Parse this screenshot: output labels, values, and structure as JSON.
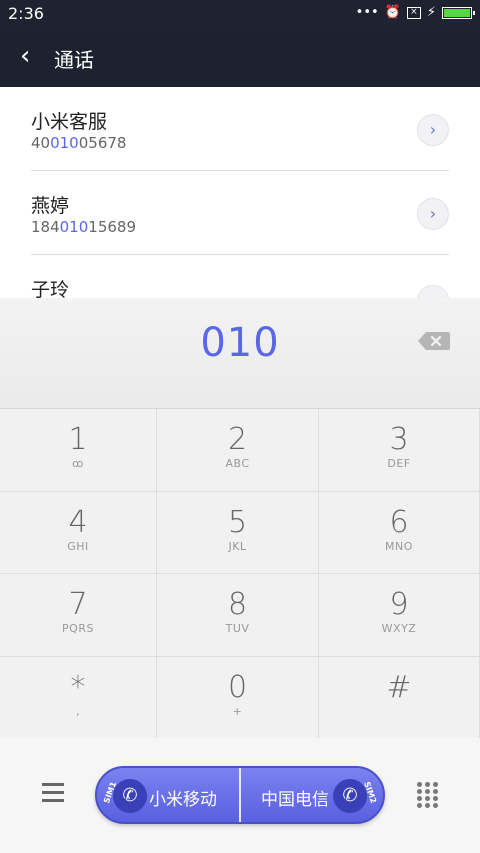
{
  "status_bar": {
    "time": "2:36",
    "dots": "•••",
    "alarm": "⏰",
    "box_x": "×",
    "bolt": "⚡",
    "battery_level": 1.0
  },
  "header": {
    "back_icon": "‹",
    "title": "通话"
  },
  "contacts": [
    {
      "name": "小米客服",
      "num_pre": "40",
      "num_hl": "010",
      "num_post": "05678"
    },
    {
      "name": "燕婷",
      "num_pre": "184",
      "num_hl": "010",
      "num_post": "15689"
    },
    {
      "name": "子玲",
      "num_pre": "",
      "num_hl": "",
      "num_post": ""
    }
  ],
  "dial_input": {
    "value": "010"
  },
  "keypad": [
    {
      "digit": "1",
      "letters": "ꝏ"
    },
    {
      "digit": "2",
      "letters": "ABC"
    },
    {
      "digit": "3",
      "letters": "DEF"
    },
    {
      "digit": "4",
      "letters": "GHI"
    },
    {
      "digit": "5",
      "letters": "JKL"
    },
    {
      "digit": "6",
      "letters": "MNO"
    },
    {
      "digit": "7",
      "letters": "PQRS"
    },
    {
      "digit": "8",
      "letters": "TUV"
    },
    {
      "digit": "9",
      "letters": "WXYZ"
    },
    {
      "digit": "*",
      "letters": ","
    },
    {
      "digit": "0",
      "letters": "+"
    },
    {
      "digit": "#",
      "letters": ""
    }
  ],
  "sim_buttons": [
    {
      "tag": "SIM1",
      "label": "小米移动"
    },
    {
      "tag": "SIM2",
      "label": "中国电信"
    }
  ],
  "colors": {
    "accent": "#5a67e8",
    "header_bg": "#1e2230"
  }
}
